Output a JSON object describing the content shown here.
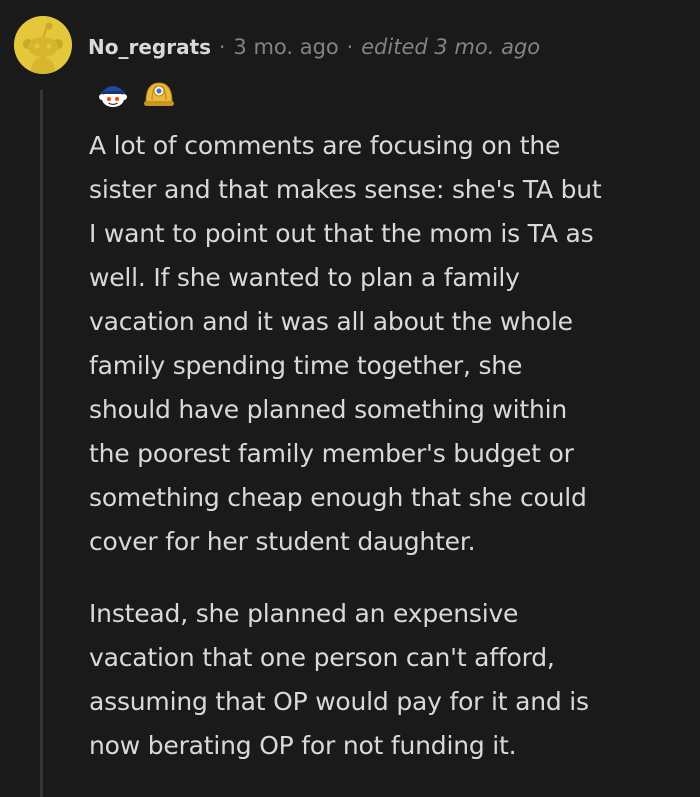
{
  "comment": {
    "author": {
      "username": "No_regrats",
      "avatar_icon": "reddit-snoo-avatar-icon"
    },
    "timestamp": "3 mo. ago",
    "edited": "edited 3 mo. ago",
    "separator": "·",
    "awards": [
      {
        "name": "snoo-cap-award-icon"
      },
      {
        "name": "gold-helmet-award-icon"
      }
    ],
    "paragraphs": [
      "A lot of comments are focusing on the\nsister and that makes sense: she's TA but\nI want to point out that the mom is TA as\nwell. If she wanted to plan a family\nvacation and it was all about the whole\nfamily spending time together, she\nshould have planned something within\nthe poorest family member's budget or\nsomething cheap enough that she could\ncover for her student daughter.",
      "Instead, she planned an expensive\nvacation that one person can't afford,\nassuming that OP would pay for it and is\nnow berating OP for not funding it."
    ]
  },
  "colors": {
    "background": "#1a1a1b",
    "text": "#d7dadc",
    "meta": "#818384",
    "avatar": "#e4c73b",
    "thread_line": "#343536"
  }
}
